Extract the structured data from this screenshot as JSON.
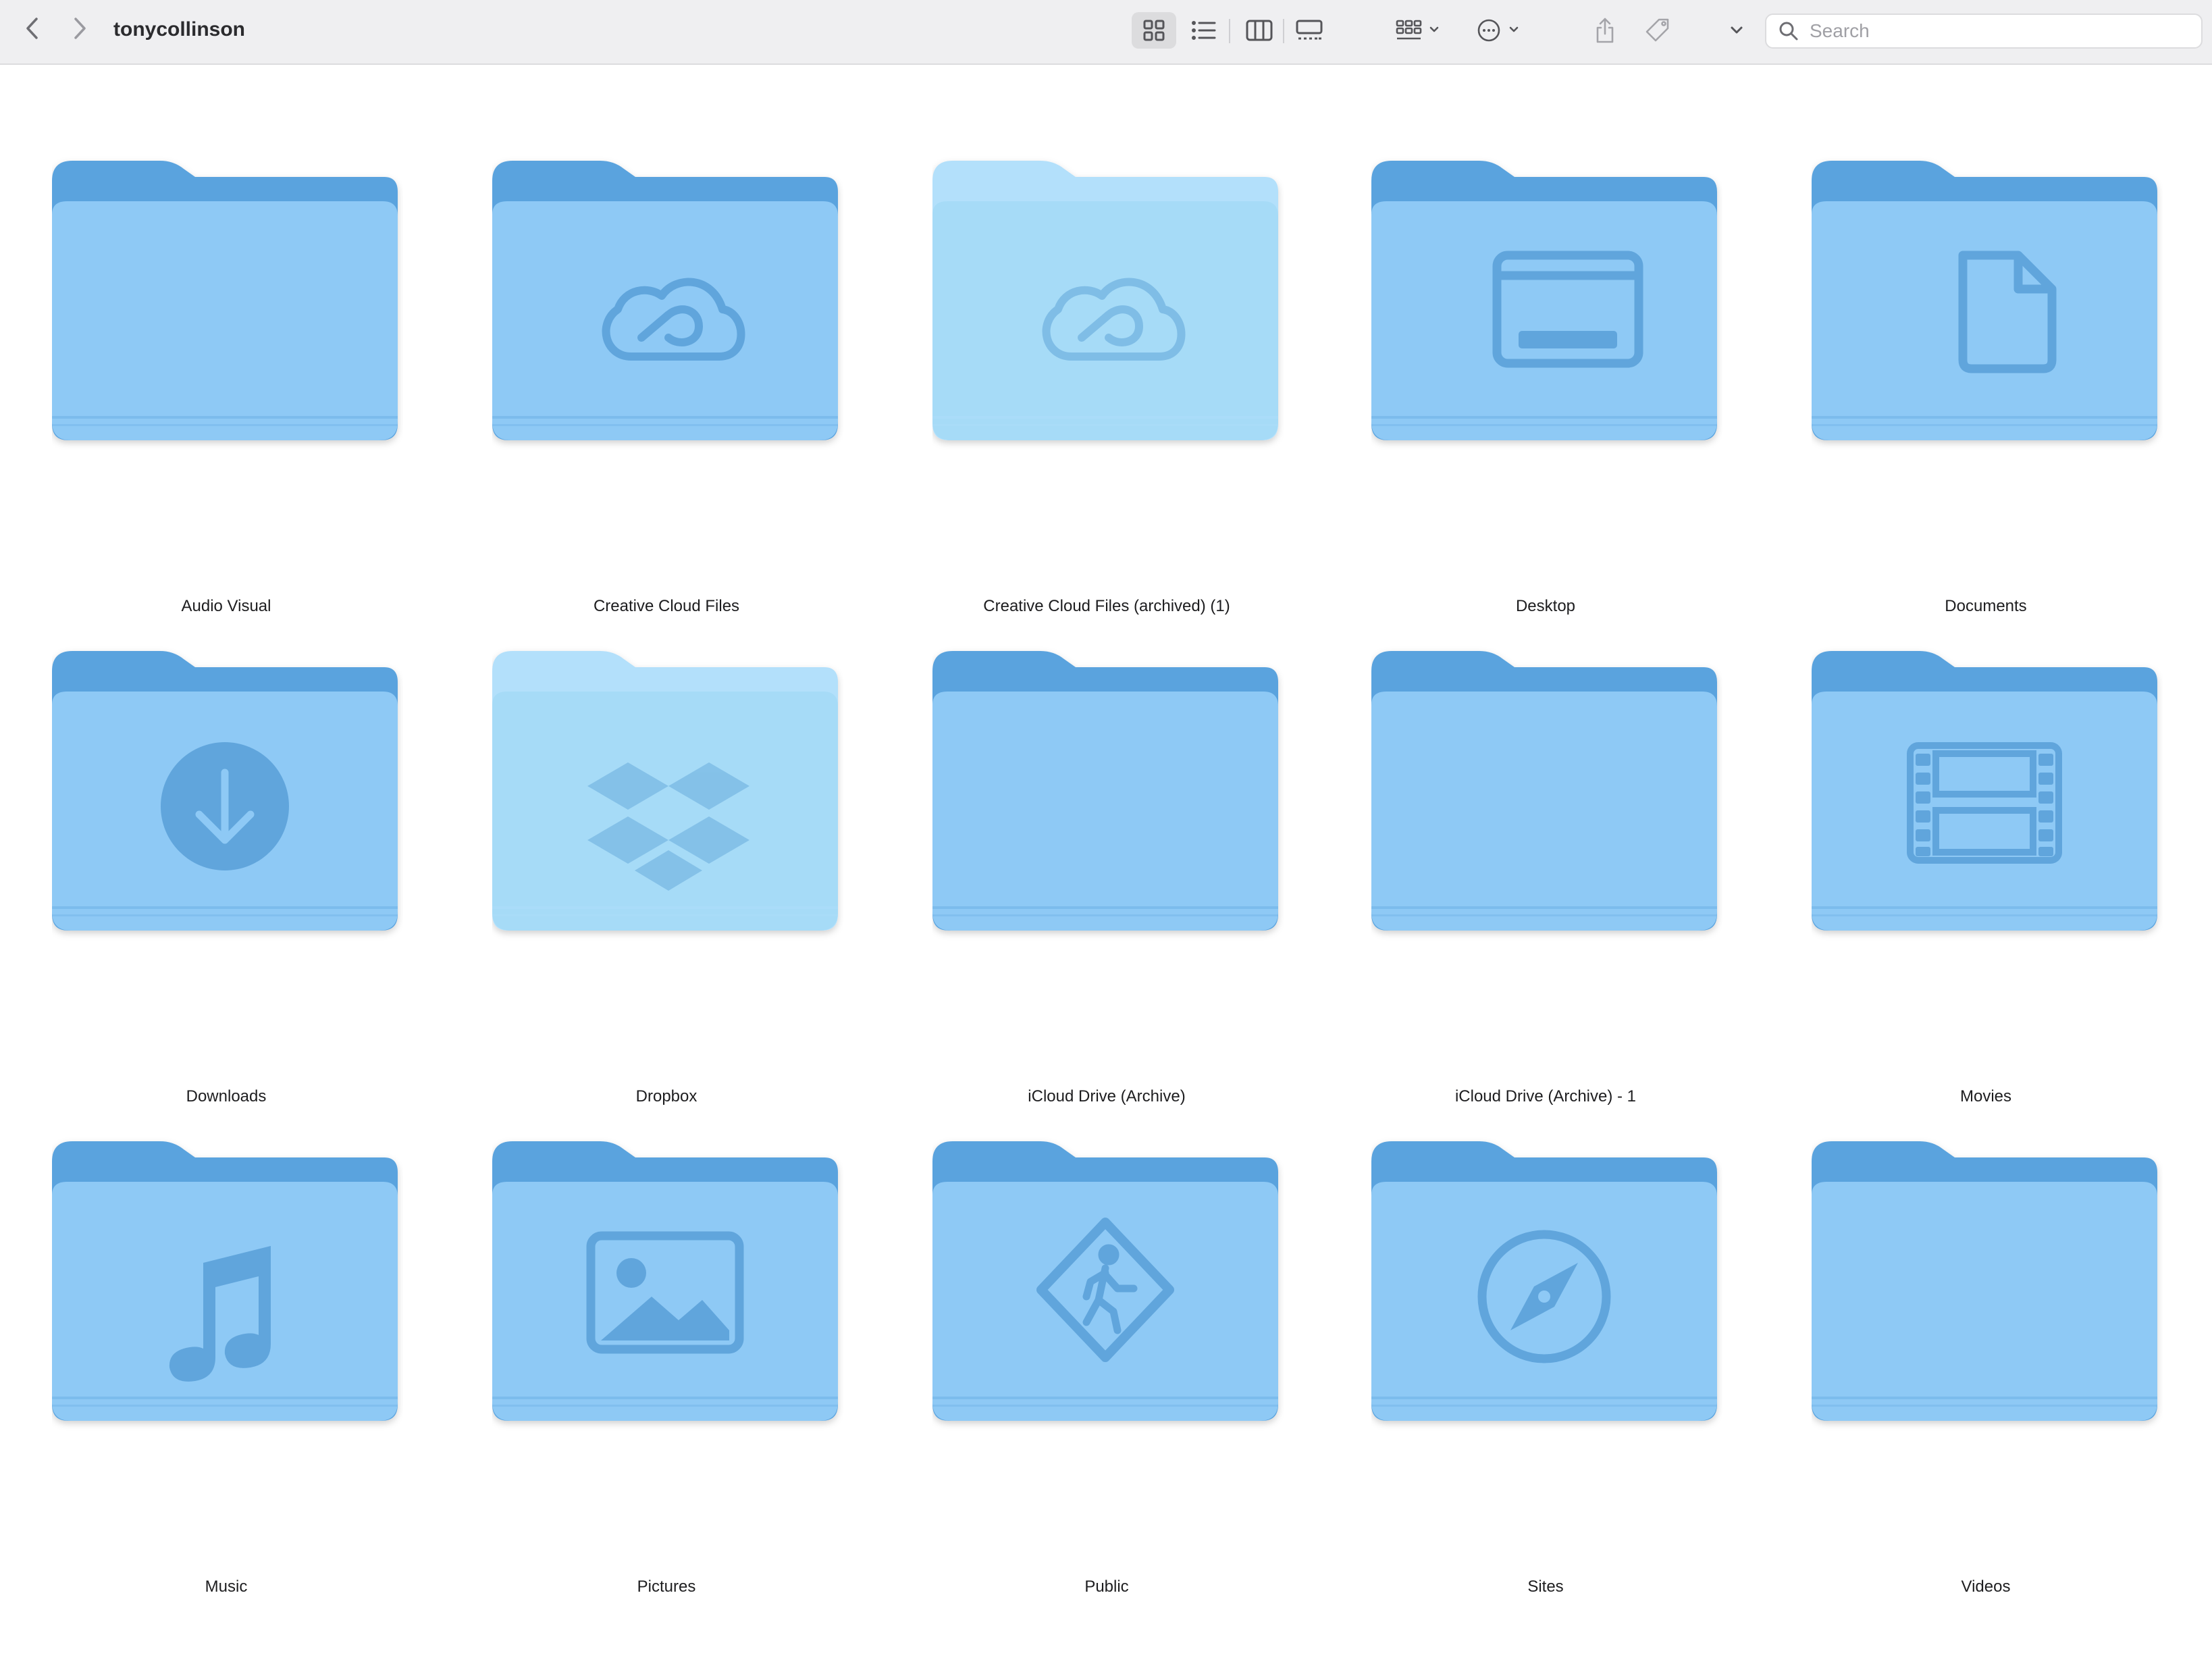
{
  "window": {
    "title": "tonycollinson"
  },
  "toolbar": {
    "back_icon": "chevron-left-icon",
    "forward_icon": "chevron-right-icon",
    "views": [
      {
        "name": "icon-view",
        "active": true
      },
      {
        "name": "list-view",
        "active": false
      },
      {
        "name": "column-view",
        "active": false
      },
      {
        "name": "gallery-view",
        "active": false
      }
    ],
    "group_icon": "group-by-icon",
    "more_icon": "ellipsis-circle-icon",
    "share_icon": "share-icon",
    "tag_icon": "tag-icon",
    "overflow_icon": "chevron-down-icon"
  },
  "search": {
    "placeholder": "Search",
    "value": ""
  },
  "colors": {
    "folder_tab": "#5aa3de",
    "folder_body": "#8ec9f5",
    "folder_glyph": "#60a5dc",
    "folder_faded_tab": "#b3e0fb",
    "folder_faded_body": "#a6dbf7"
  },
  "folders": [
    {
      "label": "Audio Visual",
      "glyph": "none",
      "faded": false
    },
    {
      "label": "Creative Cloud Files",
      "glyph": "creative-cloud",
      "faded": false
    },
    {
      "label": "Creative Cloud Files (archived) (1)",
      "glyph": "creative-cloud",
      "faded": true
    },
    {
      "label": "Desktop",
      "glyph": "desktop",
      "faded": false
    },
    {
      "label": "Documents",
      "glyph": "document",
      "faded": false
    },
    {
      "label": "Downloads",
      "glyph": "download",
      "faded": false
    },
    {
      "label": "Dropbox",
      "glyph": "dropbox",
      "faded": true
    },
    {
      "label": "iCloud Drive (Archive)",
      "glyph": "none",
      "faded": false
    },
    {
      "label": "iCloud Drive (Archive) - 1",
      "glyph": "none",
      "faded": false
    },
    {
      "label": "Movies",
      "glyph": "film",
      "faded": false
    },
    {
      "label": "Music",
      "glyph": "music-note",
      "faded": false
    },
    {
      "label": "Pictures",
      "glyph": "photo",
      "faded": false
    },
    {
      "label": "Public",
      "glyph": "pedestrian-sign",
      "faded": false
    },
    {
      "label": "Sites",
      "glyph": "compass",
      "faded": false
    },
    {
      "label": "Videos",
      "glyph": "none",
      "faded": false
    }
  ]
}
